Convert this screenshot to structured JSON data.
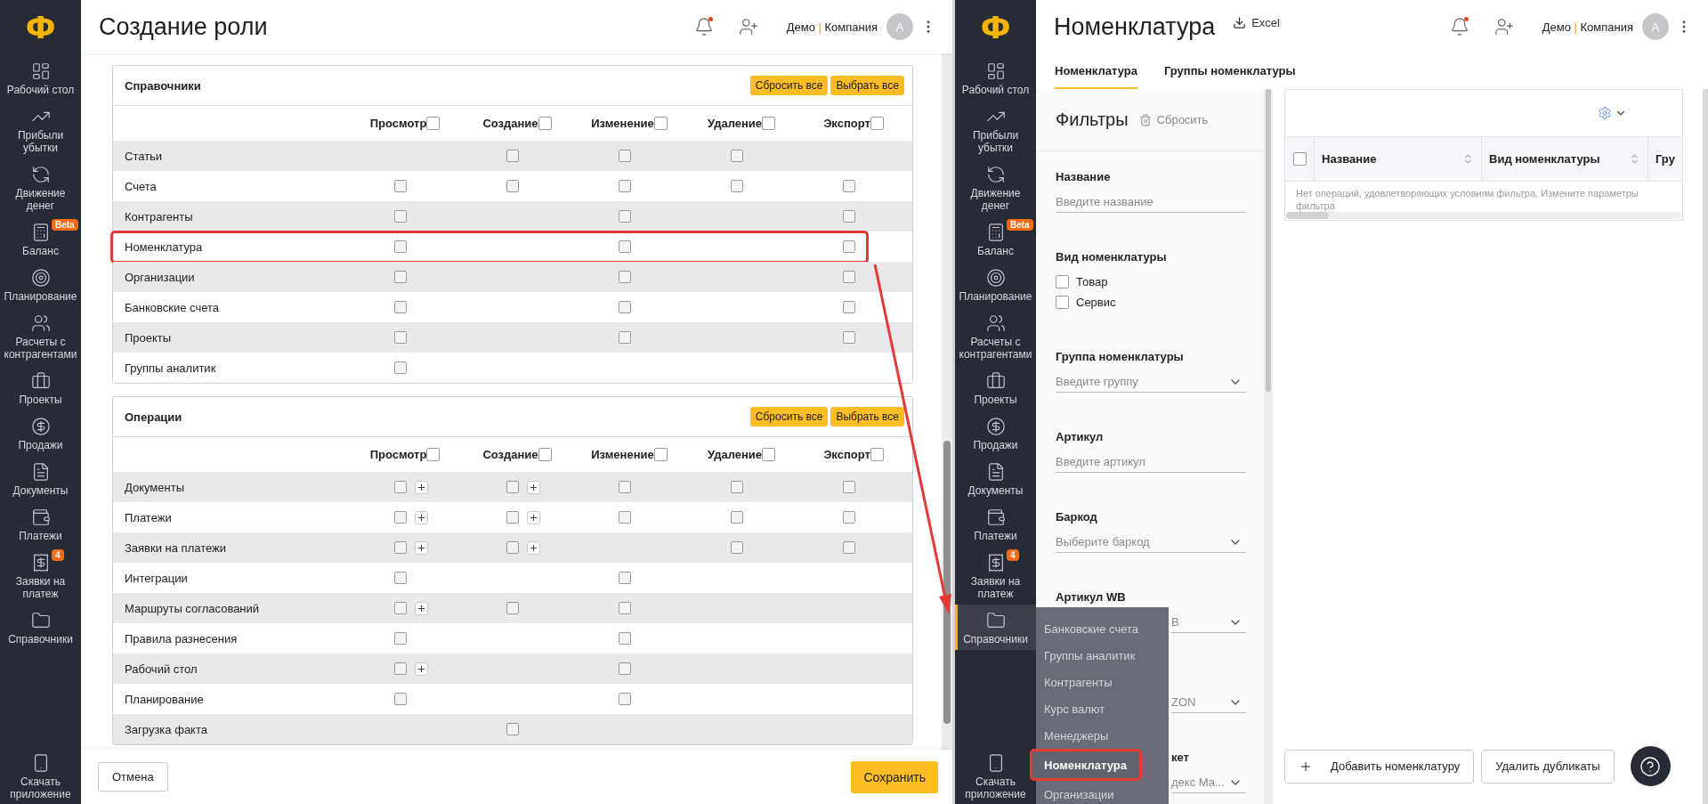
{
  "left": {
    "logo": "Ф",
    "title": "Создание роли",
    "user": {
      "name": "Демо",
      "separator": "|",
      "company": "Компания",
      "avatar": "A",
      "notification": true
    },
    "sidebar": {
      "items": [
        {
          "kind": "dashboard",
          "label": "Рабочий стол",
          "open": false
        },
        {
          "kind": "profit",
          "label": "Прибыли убытки",
          "open": false
        },
        {
          "kind": "cashflow",
          "label": "Движение денег",
          "open": false
        },
        {
          "kind": "balance",
          "label": "Баланс",
          "badge": "Beta",
          "open": false
        },
        {
          "kind": "planning",
          "label": "Планирование",
          "open": false
        },
        {
          "kind": "partners",
          "label": "Расчеты с контрагентами",
          "open": false
        },
        {
          "kind": "projects",
          "label": "Проекты",
          "open": false
        },
        {
          "kind": "sales",
          "label": "Продажи",
          "open": false
        },
        {
          "kind": "documents",
          "label": "Документы",
          "open": false
        },
        {
          "kind": "payments",
          "label": "Платежи",
          "open": false
        },
        {
          "kind": "requests",
          "label": "Заявки на платеж",
          "badge": "4",
          "open": false
        },
        {
          "kind": "catalogs",
          "label": "Справочники",
          "open": false
        }
      ],
      "download_label": "Скачать приложение"
    },
    "cards": [
      {
        "title": "Справочники",
        "reset_label": "Сбросить все",
        "select_label": "Выбрать все",
        "columns": [
          {
            "label": "Просмотр",
            "checked": false
          },
          {
            "label": "Создание",
            "checked": false
          },
          {
            "label": "Изменение",
            "checked": false
          },
          {
            "label": "Удаление",
            "checked": false
          },
          {
            "label": "Экспорт",
            "checked": false
          }
        ],
        "rows": [
          {
            "name": "Статьи",
            "highlighted": false,
            "cells": [
              {
                "kind": "empty"
              },
              {
                "kind": "checkbox",
                "checked": false
              },
              {
                "kind": "checkbox",
                "checked": false
              },
              {
                "kind": "checkbox",
                "checked": false
              },
              {
                "kind": "empty"
              }
            ]
          },
          {
            "name": "Счета",
            "highlighted": false,
            "cells": [
              {
                "kind": "checkbox",
                "checked": false
              },
              {
                "kind": "checkbox",
                "checked": false
              },
              {
                "kind": "checkbox",
                "checked": false
              },
              {
                "kind": "checkbox",
                "checked": false
              },
              {
                "kind": "checkbox",
                "checked": false
              }
            ]
          },
          {
            "name": "Контрагенты",
            "highlighted": false,
            "cells": [
              {
                "kind": "checkbox",
                "checked": false
              },
              {
                "kind": "empty"
              },
              {
                "kind": "checkbox",
                "checked": false
              },
              {
                "kind": "empty"
              },
              {
                "kind": "checkbox",
                "checked": false
              }
            ]
          },
          {
            "name": "Номенклатура",
            "highlighted": true,
            "cells": [
              {
                "kind": "checkbox",
                "checked": false
              },
              {
                "kind": "empty"
              },
              {
                "kind": "checkbox",
                "checked": false
              },
              {
                "kind": "empty"
              },
              {
                "kind": "checkbox",
                "checked": false
              }
            ]
          },
          {
            "name": "Организации",
            "highlighted": false,
            "cells": [
              {
                "kind": "checkbox",
                "checked": false
              },
              {
                "kind": "empty"
              },
              {
                "kind": "checkbox",
                "checked": false
              },
              {
                "kind": "empty"
              },
              {
                "kind": "checkbox",
                "checked": false
              }
            ]
          },
          {
            "name": "Банковские счета",
            "highlighted": false,
            "cells": [
              {
                "kind": "checkbox",
                "checked": false
              },
              {
                "kind": "empty"
              },
              {
                "kind": "checkbox",
                "checked": false
              },
              {
                "kind": "empty"
              },
              {
                "kind": "checkbox",
                "checked": false
              }
            ]
          },
          {
            "name": "Проекты",
            "highlighted": false,
            "cells": [
              {
                "kind": "checkbox",
                "checked": false
              },
              {
                "kind": "empty"
              },
              {
                "kind": "checkbox",
                "checked": false
              },
              {
                "kind": "empty"
              },
              {
                "kind": "checkbox",
                "checked": false
              }
            ]
          },
          {
            "name": "Группы аналитик",
            "highlighted": false,
            "cells": [
              {
                "kind": "checkbox",
                "checked": false
              },
              {
                "kind": "empty"
              },
              {
                "kind": "empty"
              },
              {
                "kind": "empty"
              },
              {
                "kind": "empty"
              }
            ]
          }
        ]
      },
      {
        "title": "Операции",
        "reset_label": "Сбросить все",
        "select_label": "Выбрать все",
        "columns": [
          {
            "label": "Просмотр",
            "checked": false
          },
          {
            "label": "Создание",
            "checked": false
          },
          {
            "label": "Изменение",
            "checked": false
          },
          {
            "label": "Удаление",
            "checked": false
          },
          {
            "label": "Экспорт",
            "checked": false
          }
        ],
        "rows": [
          {
            "name": "Документы",
            "highlighted": false,
            "cells": [
              {
                "kind": "checkbox_plus",
                "checked": false
              },
              {
                "kind": "checkbox_plus",
                "checked": false
              },
              {
                "kind": "checkbox",
                "checked": false
              },
              {
                "kind": "checkbox",
                "checked": false
              },
              {
                "kind": "checkbox",
                "checked": false
              }
            ]
          },
          {
            "name": "Платежи",
            "highlighted": false,
            "cells": [
              {
                "kind": "checkbox_plus",
                "checked": false
              },
              {
                "kind": "checkbox_plus",
                "checked": false
              },
              {
                "kind": "checkbox",
                "checked": false
              },
              {
                "kind": "checkbox",
                "checked": false
              },
              {
                "kind": "checkbox",
                "checked": false
              }
            ]
          },
          {
            "name": "Заявки на платежи",
            "highlighted": false,
            "cells": [
              {
                "kind": "checkbox_plus",
                "checked": false
              },
              {
                "kind": "checkbox_plus",
                "checked": false
              },
              {
                "kind": "empty"
              },
              {
                "kind": "checkbox",
                "checked": false
              },
              {
                "kind": "checkbox",
                "checked": false
              }
            ]
          },
          {
            "name": "Интеграции",
            "highlighted": false,
            "cells": [
              {
                "kind": "checkbox",
                "checked": false
              },
              {
                "kind": "empty"
              },
              {
                "kind": "checkbox",
                "checked": false
              },
              {
                "kind": "empty"
              },
              {
                "kind": "empty"
              }
            ]
          },
          {
            "name": "Маршруты согласований",
            "highlighted": false,
            "cells": [
              {
                "kind": "checkbox_plus",
                "checked": false
              },
              {
                "kind": "checkbox",
                "checked": false
              },
              {
                "kind": "checkbox",
                "checked": false
              },
              {
                "kind": "empty"
              },
              {
                "kind": "empty"
              }
            ]
          },
          {
            "name": "Правила разнесения",
            "highlighted": false,
            "cells": [
              {
                "kind": "checkbox",
                "checked": false
              },
              {
                "kind": "empty"
              },
              {
                "kind": "checkbox",
                "checked": false
              },
              {
                "kind": "empty"
              },
              {
                "kind": "empty"
              }
            ]
          },
          {
            "name": "Рабочий стол",
            "highlighted": false,
            "cells": [
              {
                "kind": "checkbox_plus",
                "checked": false
              },
              {
                "kind": "empty"
              },
              {
                "kind": "checkbox",
                "checked": false
              },
              {
                "kind": "empty"
              },
              {
                "kind": "empty"
              }
            ]
          },
          {
            "name": "Планирование",
            "highlighted": false,
            "cells": [
              {
                "kind": "checkbox",
                "checked": false
              },
              {
                "kind": "empty"
              },
              {
                "kind": "checkbox",
                "checked": false
              },
              {
                "kind": "empty"
              },
              {
                "kind": "empty"
              }
            ]
          },
          {
            "name": "Загрузка факта",
            "highlighted": false,
            "cells": [
              {
                "kind": "empty"
              },
              {
                "kind": "checkbox",
                "checked": false
              },
              {
                "kind": "empty"
              },
              {
                "kind": "empty"
              },
              {
                "kind": "empty"
              }
            ]
          }
        ]
      }
    ],
    "cancel_label": "Отмена",
    "save_label": "Сохранить"
  },
  "right": {
    "logo": "Ф",
    "title": "Номенклатура",
    "export_label": "Excel",
    "user": {
      "name": "Демо",
      "separator": "|",
      "company": "Компания",
      "avatar": "A",
      "notification": true
    },
    "sidebar": {
      "items": [
        {
          "kind": "dashboard",
          "label": "Рабочий стол",
          "open": false
        },
        {
          "kind": "profit",
          "label": "Прибыли убытки",
          "open": false
        },
        {
          "kind": "cashflow",
          "label": "Движение денег",
          "open": false
        },
        {
          "kind": "balance",
          "label": "Баланс",
          "badge": "Beta",
          "open": false
        },
        {
          "kind": "planning",
          "label": "Планирование",
          "open": false
        },
        {
          "kind": "partners",
          "label": "Расчеты с контрагентами",
          "open": false
        },
        {
          "kind": "projects",
          "label": "Проекты",
          "open": false
        },
        {
          "kind": "sales",
          "label": "Продажи",
          "open": false
        },
        {
          "kind": "documents",
          "label": "Документы",
          "open": false
        },
        {
          "kind": "payments",
          "label": "Платежи",
          "open": false
        },
        {
          "kind": "requests",
          "label": "Заявки на платеж",
          "badge": "4",
          "open": false
        },
        {
          "kind": "catalogs",
          "label": "Справочники",
          "open": true,
          "submenu": [
            {
              "label": "Банковские счета",
              "selected": false
            },
            {
              "label": "Группы аналитик",
              "selected": false
            },
            {
              "label": "Контрагенты",
              "selected": false
            },
            {
              "label": "Курс валют",
              "selected": false
            },
            {
              "label": "Менеджеры",
              "selected": false
            },
            {
              "label": "Номенклатура",
              "selected": true,
              "highlighted": true
            },
            {
              "label": "Организации",
              "selected": false
            }
          ]
        }
      ],
      "download_label": "Скачать приложение"
    },
    "tabs": [
      {
        "label": "Номенклатура",
        "selected": true
      },
      {
        "label": "Группы номенклатуры",
        "selected": false
      }
    ],
    "filters": {
      "title": "Фильтры",
      "reset_label": "Сбросить",
      "fields": [
        {
          "kind": "input",
          "label": "Название",
          "placeholder": "Введите название"
        },
        {
          "kind": "checks",
          "label": "Вид номенклатуры",
          "options": [
            {
              "label": "Товар",
              "checked": false
            },
            {
              "label": "Сервис",
              "checked": false
            }
          ]
        },
        {
          "kind": "select",
          "label": "Группа номенклатуры",
          "placeholder": "Введите группу"
        },
        {
          "kind": "input",
          "label": "Артикул",
          "placeholder": "Введите артикул"
        },
        {
          "kind": "select",
          "label": "Баркод",
          "placeholder": "Выберите баркод"
        },
        {
          "kind": "select",
          "label": "Артикул WB",
          "placeholder": "B",
          "covered": true
        },
        {
          "kind": "select",
          "placeholder": "ZON",
          "covered": true
        },
        {
          "kind": "select",
          "label_fragment": "кет",
          "placeholder": "декс Ма...",
          "covered": true
        }
      ]
    },
    "table": {
      "select_all_checked": false,
      "columns": [
        {
          "label": "Название",
          "sortable": true
        },
        {
          "label": "Вид номенклатуры",
          "sortable": true
        },
        {
          "label": "Гру",
          "sortable": false
        }
      ],
      "empty_text": "Нет операций, удовлетворяющих условиям фильтра. Измените параметры фильтра"
    },
    "add_label": "Добавить номенклатуру",
    "dedupe_label": "Удалить дубликаты"
  },
  "annotation": {
    "arrow": true
  }
}
